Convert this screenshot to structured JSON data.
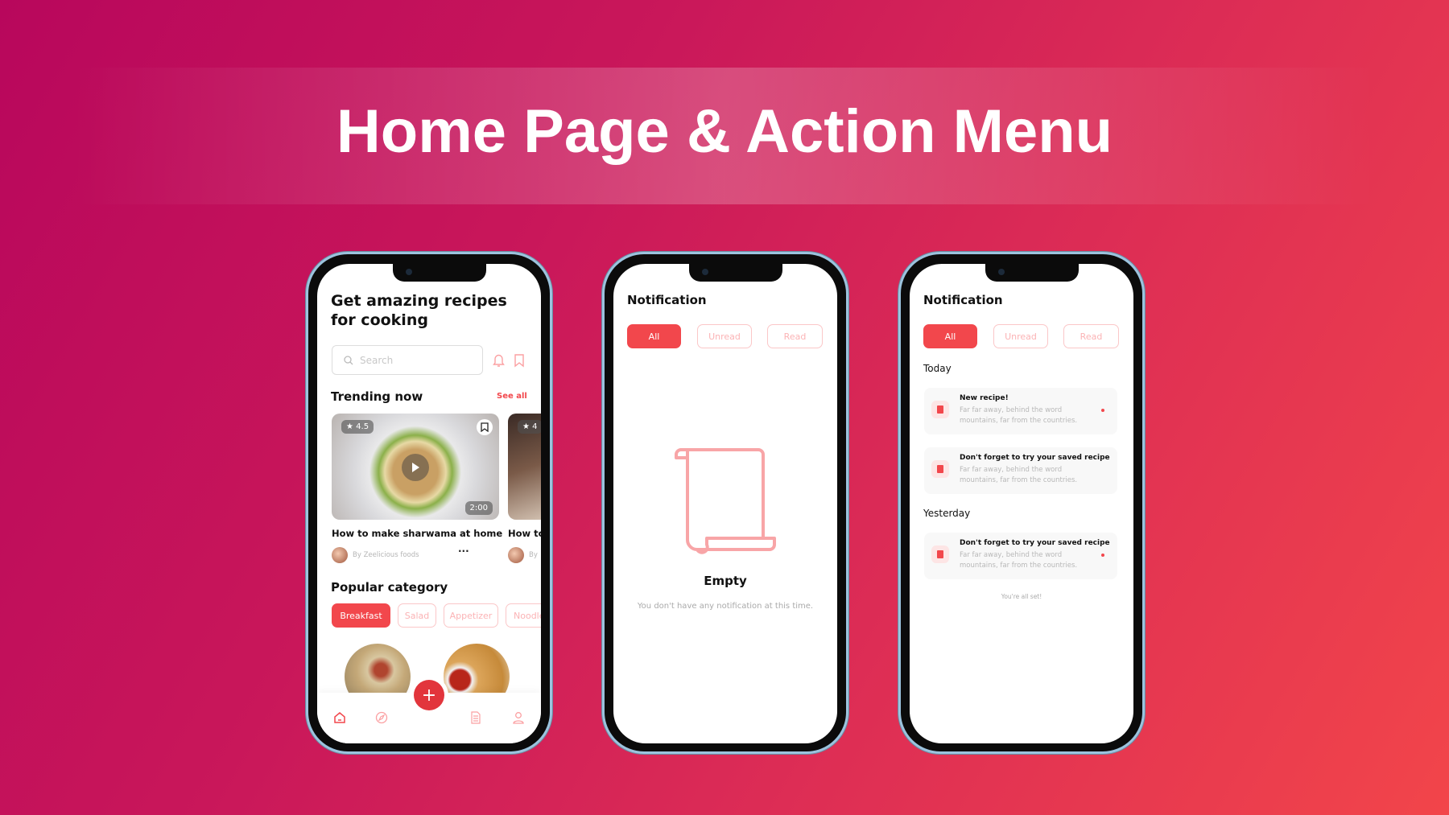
{
  "page_title": "Home Page & Action Menu",
  "colors": {
    "accent": "#f2474c",
    "accent_light": "#fbc7c8",
    "background_start": "#b8075c",
    "background_end": "#f2454a"
  },
  "home": {
    "heading": "Get amazing recipes for cooking",
    "search": {
      "placeholder": "Search",
      "icon": "search-icon"
    },
    "header_icons": [
      "bell-icon",
      "bookmark-icon"
    ],
    "trending": {
      "title": "Trending now",
      "see_all": "See all",
      "cards": [
        {
          "rating": "4.5",
          "duration": "2:00",
          "title": "How to make sharwama at home",
          "author": "By Zeelicious foods"
        },
        {
          "rating": "4",
          "title": "How to",
          "author": "By"
        }
      ]
    },
    "popular": {
      "title": "Popular category",
      "chips": [
        "Breakfast",
        "Salad",
        "Appetizer",
        "Noodle"
      ],
      "selected": "Breakfast"
    },
    "nav": [
      "home-icon",
      "compass-icon",
      "plus-icon",
      "document-icon",
      "profile-icon"
    ],
    "fab": "+"
  },
  "notif_empty": {
    "title": "Notification",
    "tabs": [
      "All",
      "Unread",
      "Read"
    ],
    "selected_tab": "All",
    "empty_title": "Empty",
    "empty_text": "You don't have any notification at this time."
  },
  "notif_list": {
    "title": "Notification",
    "tabs": [
      "All",
      "Unread",
      "Read"
    ],
    "selected_tab": "All",
    "sections": [
      {
        "label": "Today",
        "items": [
          {
            "title": "New recipe!",
            "body": "Far far away, behind the word mountains, far from the countries.",
            "unread": true
          },
          {
            "title": "Don't forget to try your saved recipe",
            "body": "Far far away, behind the word mountains, far from the countries.",
            "unread": false
          }
        ]
      },
      {
        "label": "Yesterday",
        "items": [
          {
            "title": "Don't forget to try your saved recipe",
            "body": "Far far away, behind the word mountains, far from the countries.",
            "unread": true
          }
        ]
      }
    ],
    "footer": "You're all set!"
  }
}
